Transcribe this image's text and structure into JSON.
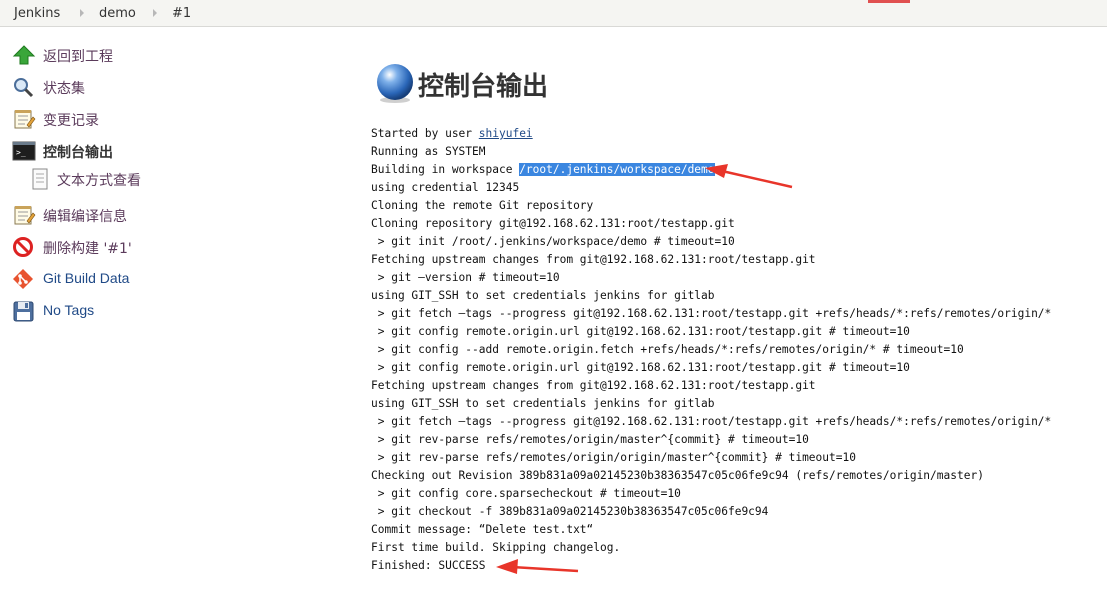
{
  "breadcrumbs": [
    "Jenkins",
    "demo",
    "#1"
  ],
  "sidebar": {
    "items": [
      {
        "label": "返回到工程",
        "icon": "up-arrow-icon"
      },
      {
        "label": "状态集",
        "icon": "magnifier-icon"
      },
      {
        "label": "变更记录",
        "icon": "notepad-icon"
      },
      {
        "label": "控制台输出",
        "icon": "terminal-icon"
      },
      {
        "label": "文本方式查看",
        "icon": "document-icon"
      },
      {
        "label": "编辑编译信息",
        "icon": "notepad-edit-icon"
      },
      {
        "label": "删除构建 '#1'",
        "icon": "no-entry-icon"
      },
      {
        "label": "Git Build Data",
        "icon": "git-icon"
      },
      {
        "label": "No Tags",
        "icon": "floppy-disk-icon"
      }
    ]
  },
  "main": {
    "title": "控制台输出",
    "console": {
      "started_prefix": "Started by user ",
      "user": "shiyufei",
      "running_as": "Running as SYSTEM",
      "building_prefix": "Building in workspace ",
      "workspace": "/root/.jenkins/workspace/demo",
      "lines": [
        "using credential 12345",
        "Cloning the remote Git repository",
        "Cloning repository git@192.168.62.131:root/testapp.git",
        " > git init /root/.jenkins/workspace/demo # timeout=10",
        "Fetching upstream changes from git@192.168.62.131:root/testapp.git",
        " > git —version # timeout=10",
        "using GIT_SSH to set credentials jenkins for gitlab",
        " > git fetch —tags --progress git@192.168.62.131:root/testapp.git +refs/heads/*:refs/remotes/origin/*",
        " > git config remote.origin.url git@192.168.62.131:root/testapp.git # timeout=10",
        " > git config --add remote.origin.fetch +refs/heads/*:refs/remotes/origin/* # timeout=10",
        " > git config remote.origin.url git@192.168.62.131:root/testapp.git # timeout=10",
        "Fetching upstream changes from git@192.168.62.131:root/testapp.git",
        "using GIT_SSH to set credentials jenkins for gitlab",
        " > git fetch —tags --progress git@192.168.62.131:root/testapp.git +refs/heads/*:refs/remotes/origin/*",
        " > git rev-parse refs/remotes/origin/master^{commit} # timeout=10",
        " > git rev-parse refs/remotes/origin/origin/master^{commit} # timeout=10",
        "Checking out Revision 389b831a09a02145230b38363547c05c06fe9c94 (refs/remotes/origin/master)",
        " > git config core.sparsecheckout # timeout=10",
        " > git checkout -f 389b831a09a02145230b38363547c05c06fe9c94",
        "Commit message: “Delete test.txt“",
        "First time build. Skipping changelog.",
        "Finished: SUCCESS"
      ]
    }
  },
  "colors": {
    "annotation_arrow": "#e8352a",
    "selection": "#3a86e0",
    "link": "#204a87"
  }
}
